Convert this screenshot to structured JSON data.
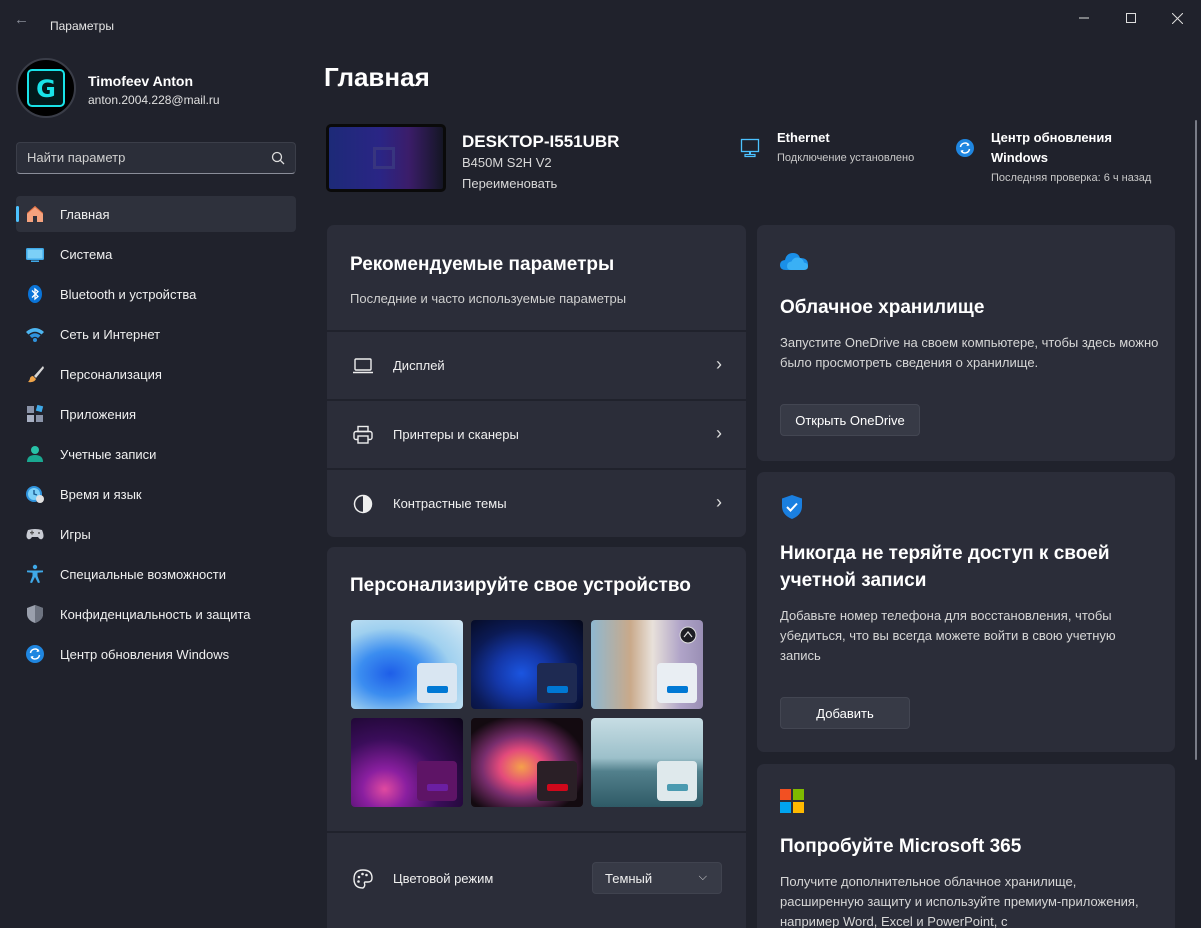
{
  "window": {
    "title": "Параметры",
    "back_glyph": "←",
    "minimize_glyph": "—",
    "maximize_glyph": "☐",
    "close_glyph": "✕"
  },
  "user": {
    "name": "Timofeev Anton",
    "email": "anton.2004.228@mail.ru",
    "avatar_letter": "G"
  },
  "search": {
    "placeholder": "Найти параметр"
  },
  "sidebar": {
    "items": [
      {
        "label": "Главная",
        "icon": "home-icon",
        "active": true
      },
      {
        "label": "Система",
        "icon": "system-icon"
      },
      {
        "label": "Bluetooth и устройства",
        "icon": "bluetooth-icon"
      },
      {
        "label": "Сеть и Интернет",
        "icon": "wifi-icon"
      },
      {
        "label": "Персонализация",
        "icon": "brush-icon"
      },
      {
        "label": "Приложения",
        "icon": "apps-icon"
      },
      {
        "label": "Учетные записи",
        "icon": "accounts-icon"
      },
      {
        "label": "Время и язык",
        "icon": "time-language-icon"
      },
      {
        "label": "Игры",
        "icon": "gamepad-icon"
      },
      {
        "label": "Специальные возможности",
        "icon": "accessibility-icon"
      },
      {
        "label": "Конфиденциальность и защита",
        "icon": "shield-icon"
      },
      {
        "label": "Центр обновления Windows",
        "icon": "update-icon"
      }
    ]
  },
  "main": {
    "title": "Главная",
    "device": {
      "name": "DESKTOP-I551UBR",
      "model": "B450M S2H V2",
      "rename": "Переименовать"
    },
    "network": {
      "title": "Ethernet",
      "status": "Подключение установлено"
    },
    "update": {
      "title": "Центр обновления Windows",
      "status": "Последняя проверка: 6 ч назад"
    },
    "recommended": {
      "title": "Рекомендуемые параметры",
      "subtitle": "Последние и часто используемые параметры",
      "items": [
        {
          "label": "Дисплей",
          "icon": "display-icon"
        },
        {
          "label": "Принтеры и сканеры",
          "icon": "printer-icon"
        },
        {
          "label": "Контрастные темы",
          "icon": "contrast-icon"
        }
      ],
      "chevron": "›"
    },
    "personalize": {
      "title": "Персонализируйте свое устройство",
      "themes": [
        {
          "name": "windows-light-theme",
          "swatch_bg": "#d9e6f2",
          "accent": "#0078d4"
        },
        {
          "name": "windows-dark-theme",
          "swatch_bg": "#1e2a52",
          "accent": "#0078d4"
        },
        {
          "name": "spotlight-theme",
          "swatch_bg": "#e9eef3",
          "accent": "#0078d4"
        },
        {
          "name": "glow-theme",
          "swatch_bg": "#5e1466",
          "accent": "#6b1fa3"
        },
        {
          "name": "captured-motion-theme",
          "swatch_bg": "#2a1f26",
          "accent": "#d0081b"
        },
        {
          "name": "flow-theme",
          "swatch_bg": "#dfe9ec",
          "accent": "#4a9ab0"
        }
      ],
      "color_mode": {
        "label": "Цветовой режим",
        "value": "Темный"
      }
    },
    "onedrive": {
      "title": "Облачное хранилище",
      "text": "Запустите OneDrive на своем компьютере, чтобы здесь можно было просмотреть сведения о хранилище.",
      "button": "Открыть OneDrive"
    },
    "account": {
      "title": "Никогда не теряйте доступ к своей учетной записи",
      "text": "Добавьте номер телефона для восстановления, чтобы убедиться, что вы всегда можете войти в свою учетную запись",
      "button": "Добавить"
    },
    "m365": {
      "title": "Попробуйте Microsoft 365",
      "text": "Получите дополнительное облачное хранилище, расширенную защиту и используйте премиум-приложения, например Word, Excel и PowerPoint, с"
    }
  },
  "colors": {
    "background": "#20222c",
    "card": "#2b2d39",
    "accent": "#4cc2ff"
  }
}
